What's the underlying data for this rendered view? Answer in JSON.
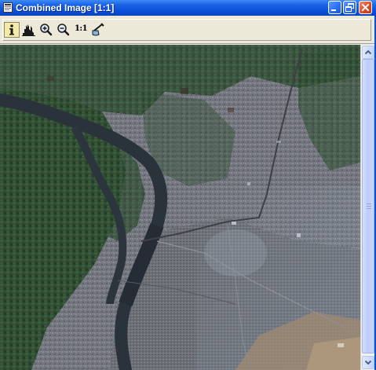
{
  "window": {
    "title": "Combined Image [1:1]",
    "app_icon": "image-window-icon",
    "titlebar_color": "#0a4fd8",
    "controls": [
      {
        "name": "minimize",
        "icon": "minimize-icon"
      },
      {
        "name": "restore",
        "icon": "restore-icon"
      },
      {
        "name": "close",
        "icon": "close-icon"
      }
    ]
  },
  "toolbar": {
    "buttons": [
      {
        "name": "info",
        "icon": "info-icon",
        "active": true
      },
      {
        "name": "histogram",
        "icon": "histogram-icon",
        "active": false
      },
      {
        "name": "zoom-in",
        "icon": "zoom-in-icon",
        "active": false
      },
      {
        "name": "zoom-out",
        "icon": "zoom-out-icon",
        "active": false
      },
      {
        "name": "actual-size",
        "icon": "actual-size-icon",
        "label": "1:1",
        "active": false
      },
      {
        "name": "contrast",
        "icon": "contrast-brush-icon",
        "active": false
      }
    ]
  },
  "image": {
    "description_icon": "satellite-image",
    "colors": {
      "vegetation": "#2d4a30",
      "urban": "#777a80",
      "water": "#2c343e",
      "desert": "#a89276"
    }
  },
  "scrollbar": {
    "up_icon": "scroll-up-arrow-icon",
    "down_icon": "scroll-down-arrow-icon"
  }
}
